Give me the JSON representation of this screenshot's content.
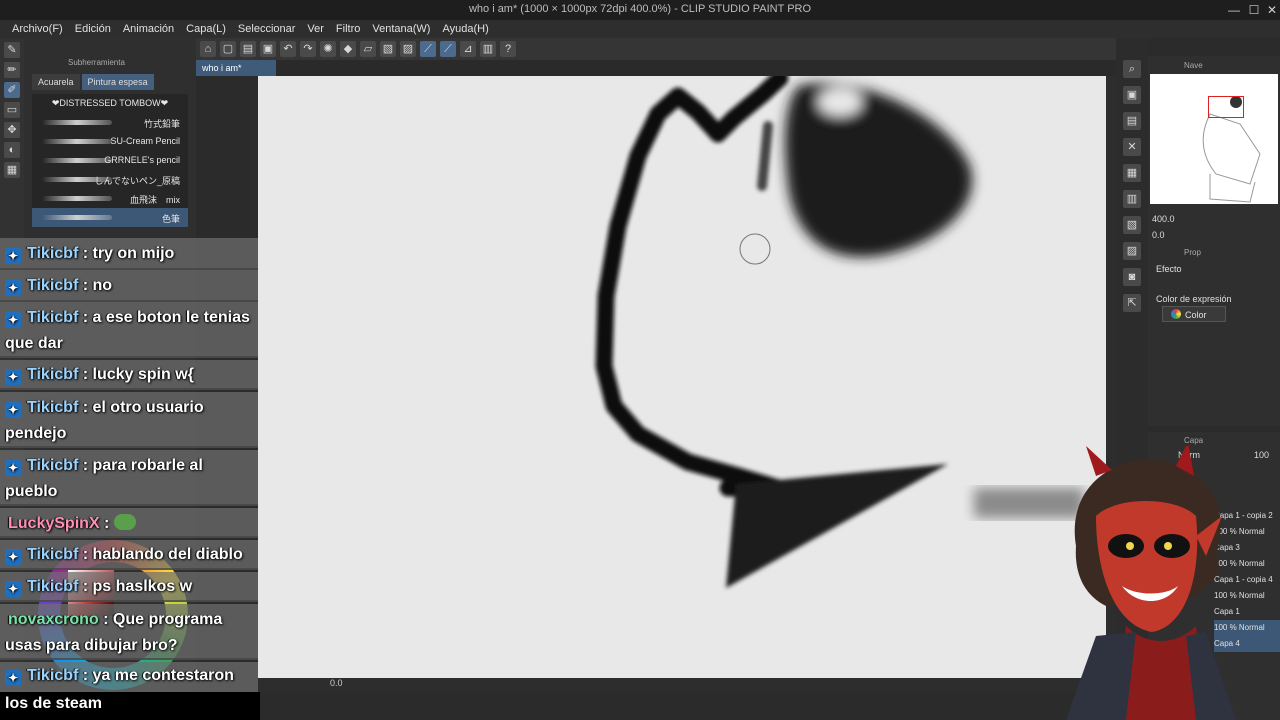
{
  "window": {
    "title": "who i am* (1000 × 1000px 72dpi 400.0%)  - CLIP STUDIO PAINT PRO",
    "min": "—",
    "max": "☐",
    "close": "✕"
  },
  "menu": [
    "Archivo(F)",
    "Edición",
    "Animación",
    "Capa(L)",
    "Seleccionar",
    "Ver",
    "Filtro",
    "Ventana(W)",
    "Ayuda(H)"
  ],
  "document_tab": "who i am*",
  "subtool": {
    "header": "Subherramienta",
    "tabs": [
      "Acuarela",
      "Pintura espesa"
    ],
    "brushes": [
      "❤DISTRESSED TOMBOW❤",
      "竹式鉛筆",
      "SU-Cream Pencil",
      "GRRNELE's pencil",
      "しんでないペン_原稿",
      "血飛沫　mix",
      "色筆"
    ]
  },
  "navigator": {
    "label": "Nave",
    "zoom": "400.0",
    "rotation": "0.0"
  },
  "properties": {
    "label": "Prop",
    "effect_label": "Efecto",
    "expression_color_label": "Color de expresión",
    "expression_color_value": "Color"
  },
  "layers": {
    "label": "Capa",
    "mode": "Norm",
    "opacity": "100",
    "rows": [
      "Capa 1 - copia 2",
      "100 % Normal",
      "Capa 3",
      "100 % Normal",
      "Capa 1 - copia 4",
      "100 % Normal",
      "Capa 1",
      "100 % Normal",
      "Capa 4"
    ]
  },
  "canvas": {
    "zoom_readout": "0.0"
  },
  "chat": [
    {
      "user": "Tikicbf",
      "text": "try on mijo",
      "color": "#9bd3ff",
      "badge": true
    },
    {
      "user": "Tikicbf",
      "text": "no",
      "color": "#9bd3ff",
      "badge": true
    },
    {
      "user": "Tikicbf",
      "text": "a ese boton le tenias",
      "cont": "que dar",
      "color": "#9bd3ff",
      "badge": true
    },
    {
      "user": "Tikicbf",
      "text": "lucky spin w{",
      "color": "#9bd3ff",
      "badge": true
    },
    {
      "user": "Tikicbf",
      "text": "el otro usuario",
      "cont": "pendejo",
      "color": "#9bd3ff",
      "badge": true
    },
    {
      "user": "Tikicbf",
      "text": "para robarle al",
      "cont": "pueblo",
      "color": "#9bd3ff",
      "badge": true
    },
    {
      "user": "LuckySpinX",
      "text": "",
      "color": "#ff8fb3",
      "badge": false
    },
    {
      "user": "Tikicbf",
      "text": "hablando del diablo",
      "color": "#9bd3ff",
      "badge": true
    },
    {
      "user": "Tikicbf",
      "text": "ps haslkos w",
      "color": "#9bd3ff",
      "badge": true
    },
    {
      "user": "novaxcrono",
      "text": "Que programa",
      "cont": "usas para dibujar bro?",
      "color": "#7ce3a8",
      "badge": false
    },
    {
      "user": "Tikicbf",
      "text": "ya me contestaron",
      "cont": "los de steam",
      "color": "#9bd3ff",
      "badge": true
    }
  ],
  "colors": {
    "accent": "#3d5876",
    "canvas_bg": "#e8e8e8",
    "avatar_skin": "#c0392b"
  }
}
